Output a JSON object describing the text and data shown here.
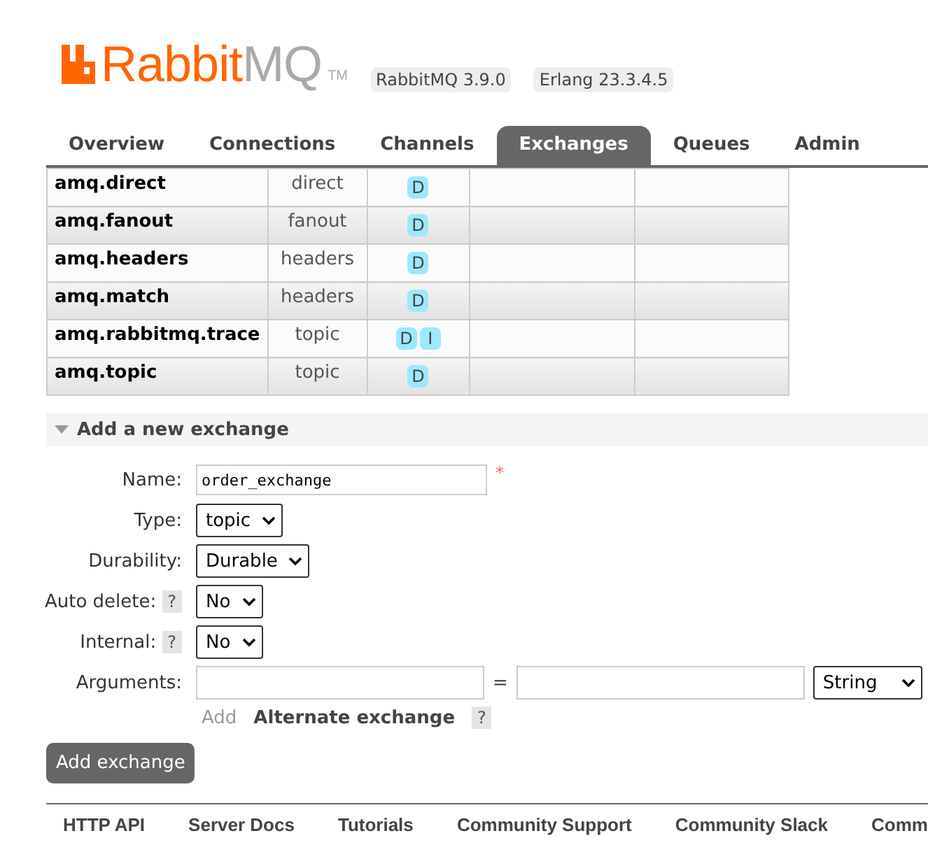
{
  "header": {
    "logo_primary": "Rabbit",
    "logo_secondary": "MQ",
    "trademark": "TM",
    "versions": [
      "RabbitMQ 3.9.0",
      "Erlang 23.3.4.5"
    ]
  },
  "tabs": [
    {
      "label": "Overview",
      "selected": false
    },
    {
      "label": "Connections",
      "selected": false
    },
    {
      "label": "Channels",
      "selected": false
    },
    {
      "label": "Exchanges",
      "selected": true
    },
    {
      "label": "Queues",
      "selected": false
    },
    {
      "label": "Admin",
      "selected": false
    }
  ],
  "exchanges": [
    {
      "name": "amq.direct",
      "type": "direct",
      "features": [
        "D"
      ]
    },
    {
      "name": "amq.fanout",
      "type": "fanout",
      "features": [
        "D"
      ]
    },
    {
      "name": "amq.headers",
      "type": "headers",
      "features": [
        "D"
      ]
    },
    {
      "name": "amq.match",
      "type": "headers",
      "features": [
        "D"
      ]
    },
    {
      "name": "amq.rabbitmq.trace",
      "type": "topic",
      "features": [
        "D",
        "I"
      ]
    },
    {
      "name": "amq.topic",
      "type": "topic",
      "features": [
        "D"
      ]
    }
  ],
  "add_section": {
    "title": "Add a new exchange",
    "expanded": true,
    "fields": [
      {
        "kind": "text",
        "label": "Name:",
        "value": "order_exchange",
        "required_mark": "*"
      },
      {
        "kind": "select",
        "label": "Type:",
        "value": "topic"
      },
      {
        "kind": "select",
        "label": "Durability:",
        "value": "Durable"
      },
      {
        "kind": "select",
        "label": "Auto delete:",
        "value": "No",
        "help": "?"
      },
      {
        "kind": "select",
        "label": "Internal:",
        "value": "No",
        "help": "?"
      },
      {
        "kind": "arguments",
        "label": "Arguments:",
        "equals": "=",
        "value_type": "String"
      }
    ],
    "add_link": "Add",
    "alternate_label": "Alternate exchange",
    "alternate_help": "?",
    "submit": "Add exchange"
  },
  "footer_links": [
    "HTTP API",
    "Server Docs",
    "Tutorials",
    "Community Support",
    "Community Slack",
    "Comm"
  ]
}
